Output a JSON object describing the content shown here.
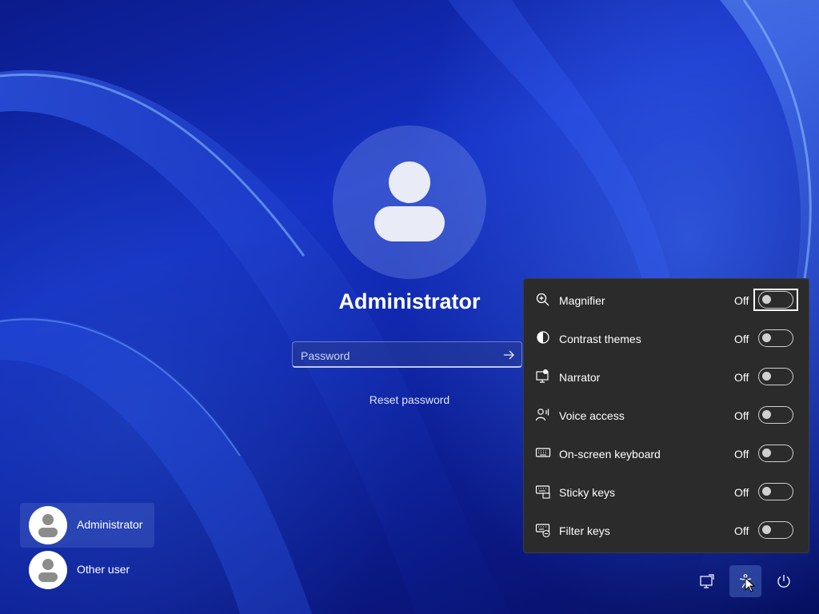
{
  "login": {
    "username": "Administrator",
    "password_placeholder": "Password",
    "reset_password": "Reset password"
  },
  "users": [
    {
      "name": "Administrator",
      "selected": true
    },
    {
      "name": "Other user",
      "selected": false
    }
  ],
  "accessibility": {
    "items": [
      {
        "label": "Magnifier",
        "state": "Off",
        "icon": "magnifier-icon"
      },
      {
        "label": "Contrast themes",
        "state": "Off",
        "icon": "contrast-icon"
      },
      {
        "label": "Narrator",
        "state": "Off",
        "icon": "narrator-icon"
      },
      {
        "label": "Voice access",
        "state": "Off",
        "icon": "voice-access-icon"
      },
      {
        "label": "On-screen keyboard",
        "state": "Off",
        "icon": "keyboard-icon"
      },
      {
        "label": "Sticky keys",
        "state": "Off",
        "icon": "sticky-keys-icon"
      },
      {
        "label": "Filter keys",
        "state": "Off",
        "icon": "filter-keys-icon"
      }
    ]
  },
  "tray": {
    "icons": [
      "network-icon",
      "accessibility-icon",
      "power-icon"
    ]
  },
  "colors": {
    "background_blue": "#1430c4",
    "flyout_bg": "#2b2b2b",
    "text": "#ffffff"
  }
}
